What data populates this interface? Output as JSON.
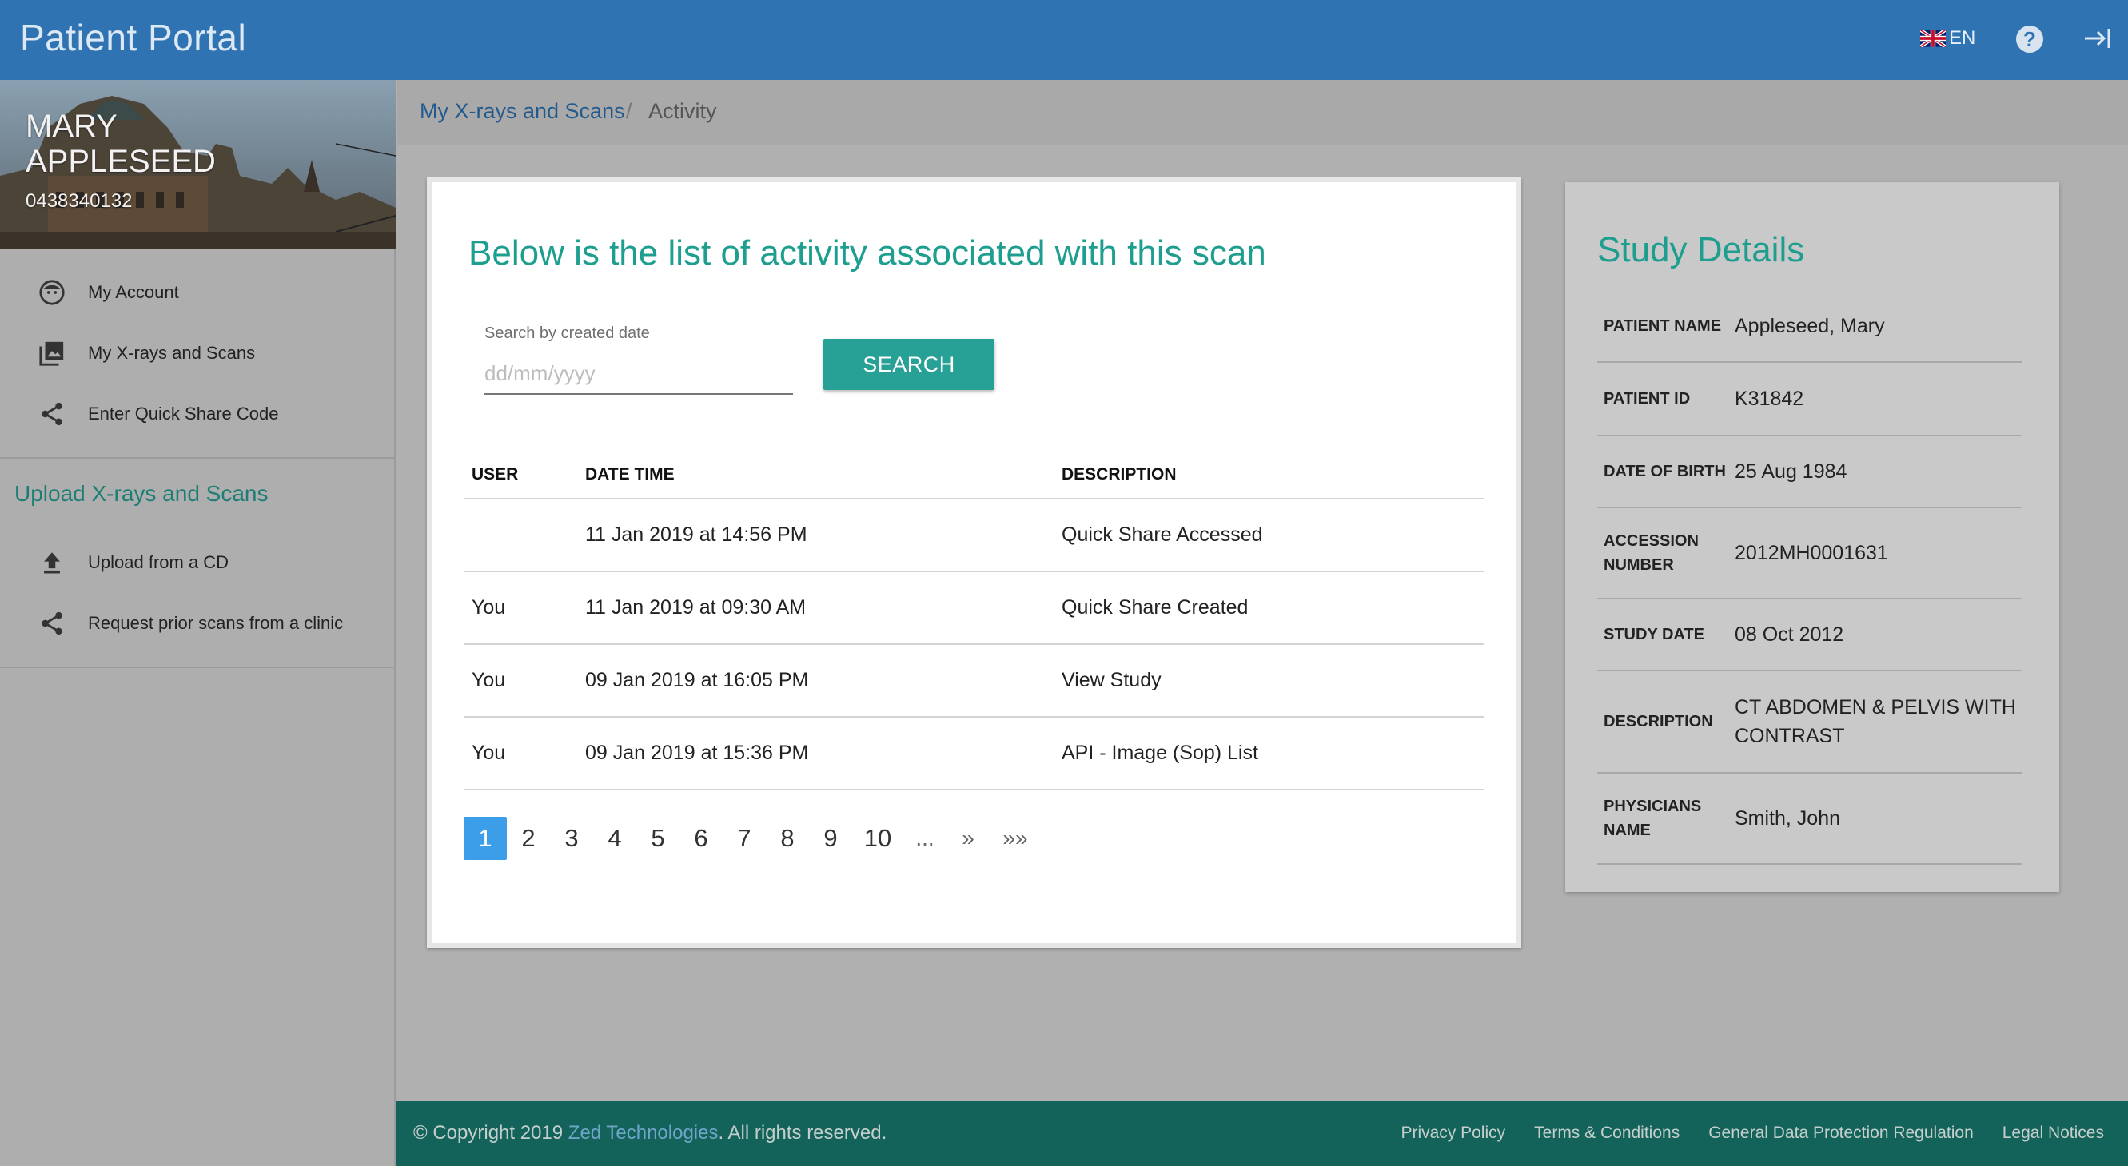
{
  "app": {
    "title": "Patient Portal",
    "language": "EN"
  },
  "profile": {
    "name": "MARY APPLESEED",
    "phone": "0438340132"
  },
  "sidebar": {
    "items": [
      {
        "label": "My Account",
        "icon": "face-icon"
      },
      {
        "label": "My X-rays and Scans",
        "icon": "image-library-icon"
      },
      {
        "label": "Enter Quick Share Code",
        "icon": "share-icon"
      }
    ],
    "upload_section_title": "Upload X-rays and Scans",
    "upload_items": [
      {
        "label": "Upload from a CD",
        "icon": "upload-icon"
      },
      {
        "label": "Request prior scans from a clinic",
        "icon": "share-icon"
      }
    ]
  },
  "breadcrumb": {
    "parent": "My X-rays and Scans",
    "separator": "/",
    "current": "Activity"
  },
  "activity": {
    "heading": "Below is the list of activity associated with this scan",
    "search": {
      "label": "Search by created date",
      "placeholder": "dd/mm/yyyy",
      "value": "",
      "button": "SEARCH"
    },
    "columns": [
      "USER",
      "DATE TIME",
      "DESCRIPTION"
    ],
    "rows": [
      {
        "user": "",
        "datetime": "11 Jan 2019 at 14:56 PM",
        "description": "Quick Share Accessed"
      },
      {
        "user": "You",
        "datetime": "11 Jan 2019 at 09:30 AM",
        "description": "Quick Share Created"
      },
      {
        "user": "You",
        "datetime": "09 Jan 2019 at 16:05 PM",
        "description": "View Study"
      },
      {
        "user": "You",
        "datetime": "09 Jan 2019 at 15:36 PM",
        "description": "API - Image (Sop) List"
      }
    ],
    "pagination": {
      "pages": [
        "1",
        "2",
        "3",
        "4",
        "5",
        "6",
        "7",
        "8",
        "9",
        "10"
      ],
      "current": "1",
      "ellipsis": "...",
      "next": "»",
      "last": "»»"
    }
  },
  "study_details": {
    "title": "Study Details",
    "fields": [
      {
        "key": "PATIENT NAME",
        "value": "Appleseed, Mary"
      },
      {
        "key": "PATIENT ID",
        "value": "K31842"
      },
      {
        "key": "DATE OF BIRTH",
        "value": "25 Aug 1984"
      },
      {
        "key": "ACCESSION NUMBER",
        "value": "2012MH0001631"
      },
      {
        "key": "STUDY DATE",
        "value": "08 Oct 2012"
      },
      {
        "key": "DESCRIPTION",
        "value": "CT ABDOMEN & PELVIS WITH CONTRAST"
      },
      {
        "key": "PHYSICIANS NAME",
        "value": "Smith, John"
      }
    ]
  },
  "footer": {
    "copyright_prefix": "© Copyright 2019",
    "company": "Zed Technologies",
    "copyright_suffix": ". All rights reserved.",
    "links": [
      "Privacy Policy",
      "Terms & Conditions",
      "General Data Protection Regulation",
      "Legal Notices"
    ]
  },
  "colors": {
    "header": "#2f73b3",
    "accent": "#1e9e8f",
    "button": "#27a196",
    "footer": "#14635a",
    "page_active": "#3c9ee8"
  }
}
